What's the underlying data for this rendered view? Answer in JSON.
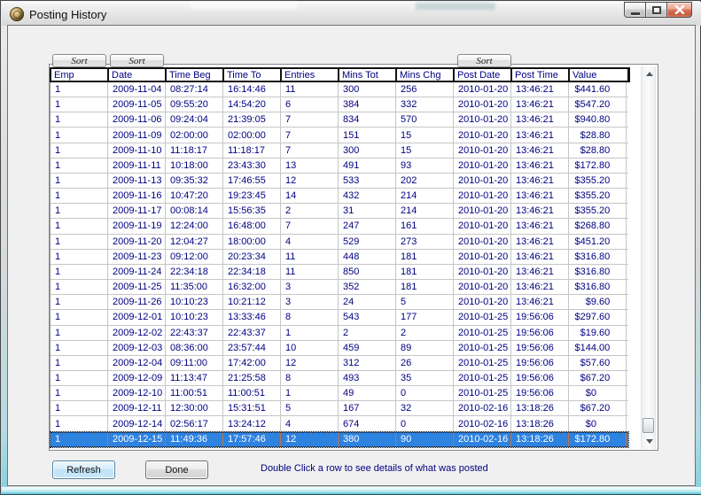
{
  "window": {
    "title": "Posting History"
  },
  "titlebar": {
    "buttons": [
      "minimize",
      "maximize",
      "close"
    ]
  },
  "sort_buttons": [
    {
      "label": "Sort"
    },
    {
      "label": "Sort"
    },
    {
      "label": "Sort"
    }
  ],
  "table": {
    "columns": [
      "Emp",
      "Date",
      "Time Beg",
      "Time To",
      "Entries",
      "Mins Tot",
      "Mins Chg",
      "Post Date",
      "Post Time",
      "Value"
    ],
    "rows": [
      [
        "1",
        "2009-11-04",
        "08:27:14",
        "16:14:46",
        "11",
        "300",
        "256",
        "2010-01-20",
        "13:46:21",
        "$441.60"
      ],
      [
        "1",
        "2009-11-05",
        "09:55:20",
        "14:54:20",
        "6",
        "384",
        "332",
        "2010-01-20",
        "13:46:21",
        "$547.20"
      ],
      [
        "1",
        "2009-11-06",
        "09:24:04",
        "21:39:05",
        "7",
        "834",
        "570",
        "2010-01-20",
        "13:46:21",
        "$940.80"
      ],
      [
        "1",
        "2009-11-09",
        "02:00:00",
        "02:00:00",
        "7",
        "151",
        "15",
        "2010-01-20",
        "13:46:21",
        "$28.80"
      ],
      [
        "1",
        "2009-11-10",
        "11:18:17",
        "11:18:17",
        "7",
        "300",
        "15",
        "2010-01-20",
        "13:46:21",
        "$28.80"
      ],
      [
        "1",
        "2009-11-11",
        "10:18:00",
        "23:43:30",
        "13",
        "491",
        "93",
        "2010-01-20",
        "13:46:21",
        "$172.80"
      ],
      [
        "1",
        "2009-11-13",
        "09:35:32",
        "17:46:55",
        "12",
        "533",
        "202",
        "2010-01-20",
        "13:46:21",
        "$355.20"
      ],
      [
        "1",
        "2009-11-16",
        "10:47:20",
        "19:23:45",
        "14",
        "432",
        "214",
        "2010-01-20",
        "13:46:21",
        "$355.20"
      ],
      [
        "1",
        "2009-11-17",
        "00:08:14",
        "15:56:35",
        "2",
        "31",
        "214",
        "2010-01-20",
        "13:46:21",
        "$355.20"
      ],
      [
        "1",
        "2009-11-19",
        "12:24:00",
        "16:48:00",
        "7",
        "247",
        "161",
        "2010-01-20",
        "13:46:21",
        "$268.80"
      ],
      [
        "1",
        "2009-11-20",
        "12:04:27",
        "18:00:00",
        "4",
        "529",
        "273",
        "2010-01-20",
        "13:46:21",
        "$451.20"
      ],
      [
        "1",
        "2009-11-23",
        "09:12:00",
        "20:23:34",
        "11",
        "448",
        "181",
        "2010-01-20",
        "13:46:21",
        "$316.80"
      ],
      [
        "1",
        "2009-11-24",
        "22:34:18",
        "22:34:18",
        "11",
        "850",
        "181",
        "2010-01-20",
        "13:46:21",
        "$316.80"
      ],
      [
        "1",
        "2009-11-25",
        "11:35:00",
        "16:32:00",
        "3",
        "352",
        "181",
        "2010-01-20",
        "13:46:21",
        "$316.80"
      ],
      [
        "1",
        "2009-11-26",
        "10:10:23",
        "10:21:12",
        "3",
        "24",
        "5",
        "2010-01-20",
        "13:46:21",
        "$9.60"
      ],
      [
        "1",
        "2009-12-01",
        "10:10:23",
        "13:33:46",
        "8",
        "543",
        "177",
        "2010-01-25",
        "19:56:06",
        "$297.60"
      ],
      [
        "1",
        "2009-12-02",
        "22:43:37",
        "22:43:37",
        "1",
        "2",
        "2",
        "2010-01-25",
        "19:56:06",
        "$19.60"
      ],
      [
        "1",
        "2009-12-03",
        "08:36:00",
        "23:57:44",
        "10",
        "459",
        "89",
        "2010-01-25",
        "19:56:06",
        "$144.00"
      ],
      [
        "1",
        "2009-12-04",
        "09:11:00",
        "17:42:00",
        "12",
        "312",
        "26",
        "2010-01-25",
        "19:56:06",
        "$57.60"
      ],
      [
        "1",
        "2009-12-09",
        "11:13:47",
        "21:25:58",
        "8",
        "493",
        "35",
        "2010-01-25",
        "19:56:06",
        "$67.20"
      ],
      [
        "1",
        "2009-12-10",
        "11:00:51",
        "11:00:51",
        "1",
        "49",
        "0",
        "2010-01-25",
        "19:56:06",
        "$0"
      ],
      [
        "1",
        "2009-12-11",
        "12:30:00",
        "15:31:51",
        "5",
        "167",
        "32",
        "2010-02-16",
        "13:18:26",
        "$67.20"
      ],
      [
        "1",
        "2009-12-14",
        "02:56:17",
        "13:24:12",
        "4",
        "674",
        "0",
        "2010-02-16",
        "13:18:26",
        "$0"
      ],
      [
        "1",
        "2009-12-15",
        "11:49:36",
        "17:57:46",
        "12",
        "380",
        "90",
        "2010-02-16",
        "13:18:26",
        "$172.80"
      ]
    ],
    "selected_row_index": 23
  },
  "footer": {
    "refresh_label": "Refresh",
    "done_label": "Done",
    "hint": "Double Click a row to see details of what was posted"
  },
  "colors": {
    "selection_background": "#2E82E0",
    "cell_text": "#000080",
    "hint_text": "#000080",
    "close_button": "#D8775C"
  }
}
